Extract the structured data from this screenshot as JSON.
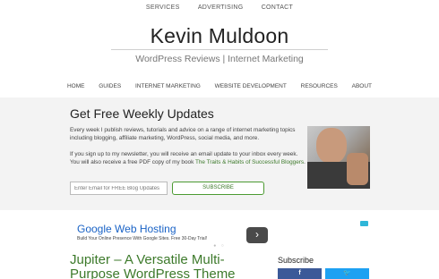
{
  "topnav": {
    "items": [
      "SERVICES",
      "ADVERTISING",
      "CONTACT"
    ]
  },
  "site": {
    "title": "Kevin Muldoon",
    "tagline": "WordPress Reviews | Internet Marketing"
  },
  "mainnav": {
    "items": [
      "HOME",
      "GUIDES",
      "INTERNET MARKETING",
      "WEBSITE DEVELOPMENT",
      "RESOURCES",
      "ABOUT"
    ]
  },
  "optin": {
    "title": "Get Free Weekly Updates",
    "paragraph1": "Every week I publish reviews, tutorials and advice on a range of internet marketing topics including blogging, affiliate marketing, WordPress, social media, and more.",
    "paragraph2_start": "If you sign up to my newsletter, you will receive an email update to your inbox every week. You will also receive a free PDF copy of my book ",
    "paragraph2_link": "The Traits & Habits of Successful Bloggers",
    "paragraph2_end": ".",
    "email_placeholder": "Enter Email for FREE Blog Updates",
    "subscribe_label": "SUBSCRIBE"
  },
  "ad": {
    "title": "Google Web Hosting",
    "subtitle": "Build Your Online Presence With Google Sites. Free 30-Day Trial!",
    "next_glyph": "›",
    "dots": "● ○"
  },
  "post": {
    "title": "Jupiter – A Versatile Multi-Purpose WordPress Theme"
  },
  "sidebar": {
    "title": "Subscribe",
    "facebook_glyph": "f",
    "twitter_glyph": "🐦"
  },
  "colors": {
    "accent_green": "#3d7a2b",
    "facebook": "#3b5998",
    "twitter": "#1da1f2",
    "ad_link": "#1a63c6"
  }
}
